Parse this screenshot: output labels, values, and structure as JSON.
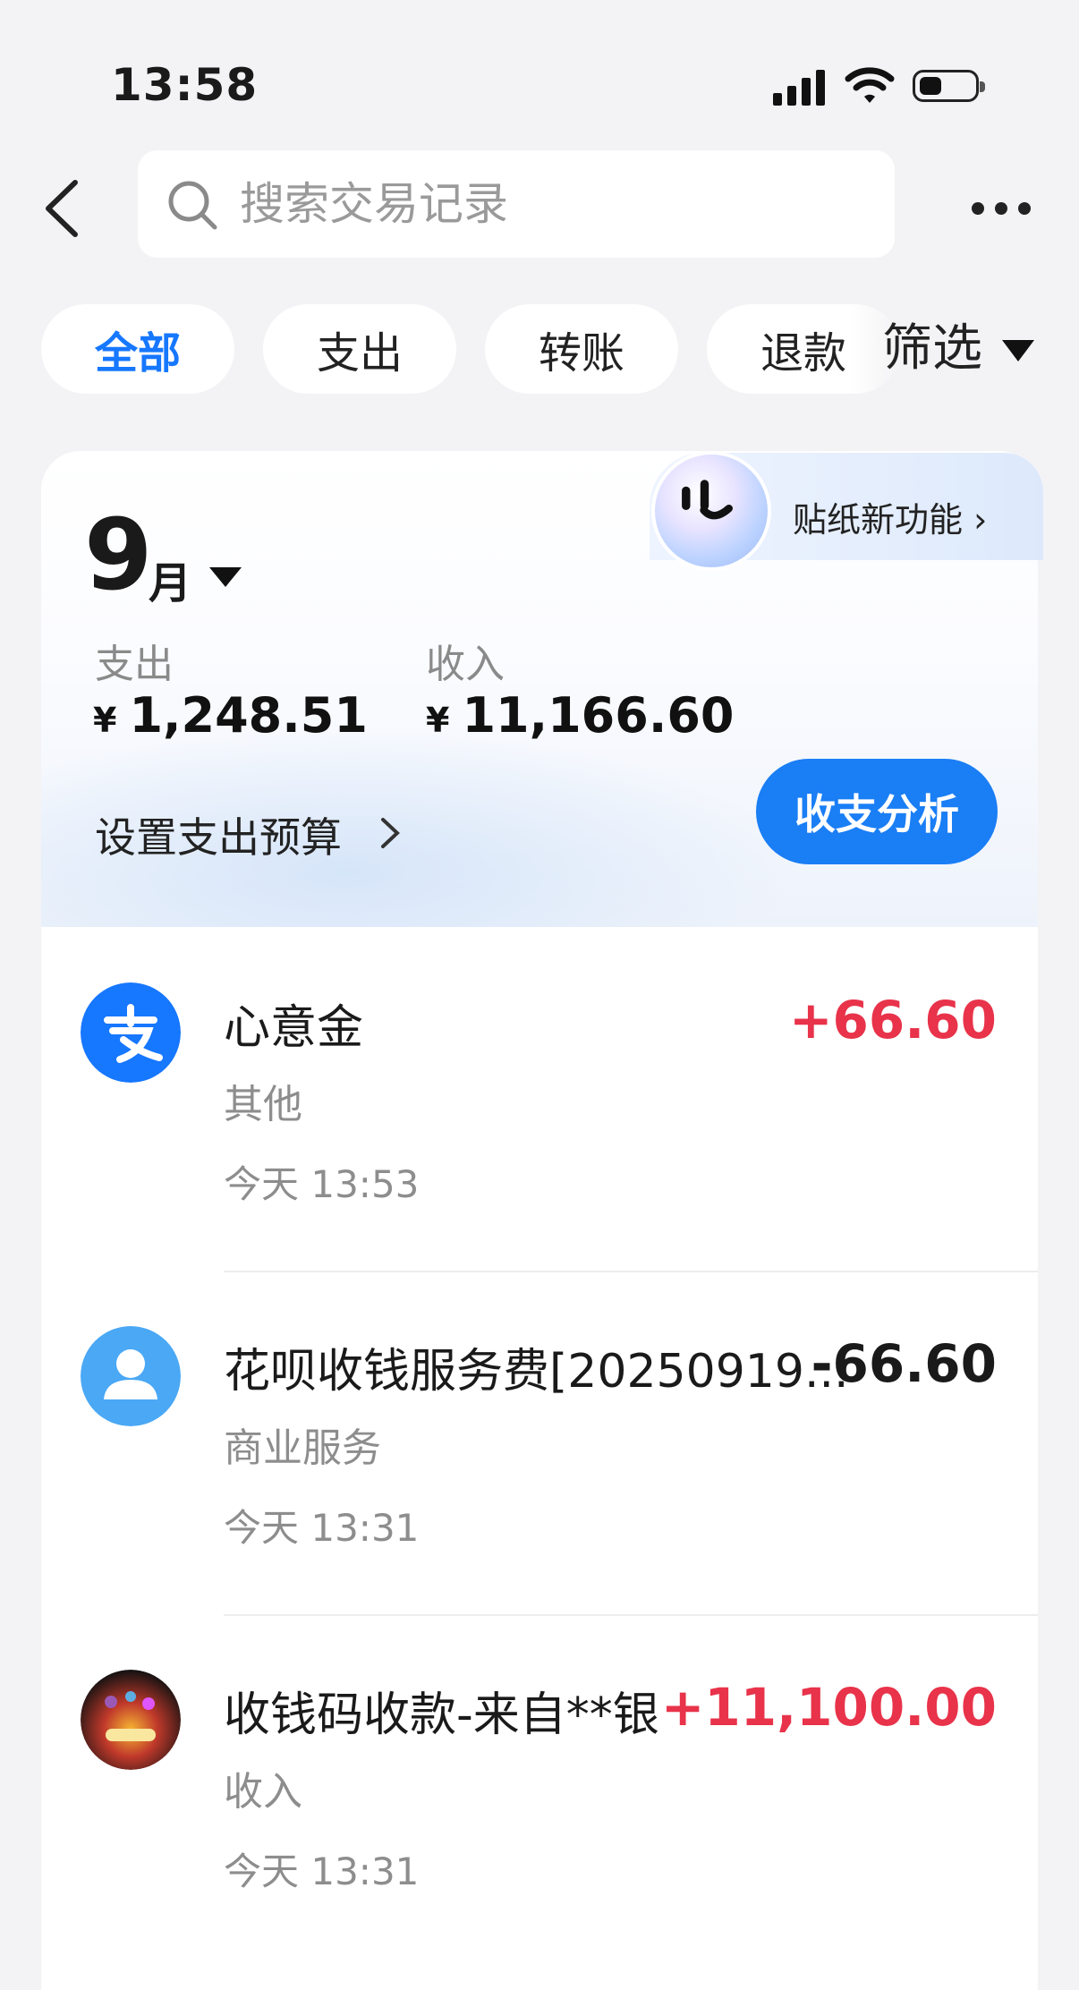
{
  "status_bar": {
    "time": "13:58"
  },
  "search": {
    "placeholder": "搜索交易记录"
  },
  "filters": {
    "chips": [
      "全部",
      "支出",
      "转账",
      "退款"
    ],
    "active": "全部",
    "filter_label": "筛选"
  },
  "summary": {
    "month_number": "9",
    "month_unit": "月",
    "expense_label": "支出",
    "expense_currency": "¥",
    "expense_amount": "1,248.51",
    "income_label": "收入",
    "income_currency": "¥",
    "income_amount": "11,166.60",
    "budget_link": "设置支出预算",
    "analysis_button": "收支分析",
    "sticker_promo": "贴纸新功能"
  },
  "transactions": [
    {
      "title": "心意金",
      "amount": "+66.60",
      "category": "其他",
      "time": "今天 13:53",
      "avatar_icon": "alipay-icon",
      "direction": "in"
    },
    {
      "title": "花呗收钱服务费[20250919...",
      "amount": "-66.60",
      "category": "商业服务",
      "time": "今天 13:31",
      "avatar_icon": "user-icon",
      "direction": "out"
    },
    {
      "title": "收钱码收款-来自**银",
      "amount": "+11,100.00",
      "category": "收入",
      "time": "今天 13:31",
      "avatar_icon": "photo-avatar",
      "direction": "in"
    }
  ],
  "colors": {
    "accent": "#1677ff",
    "income": "#e8334a",
    "background": "#f3f3f5"
  }
}
